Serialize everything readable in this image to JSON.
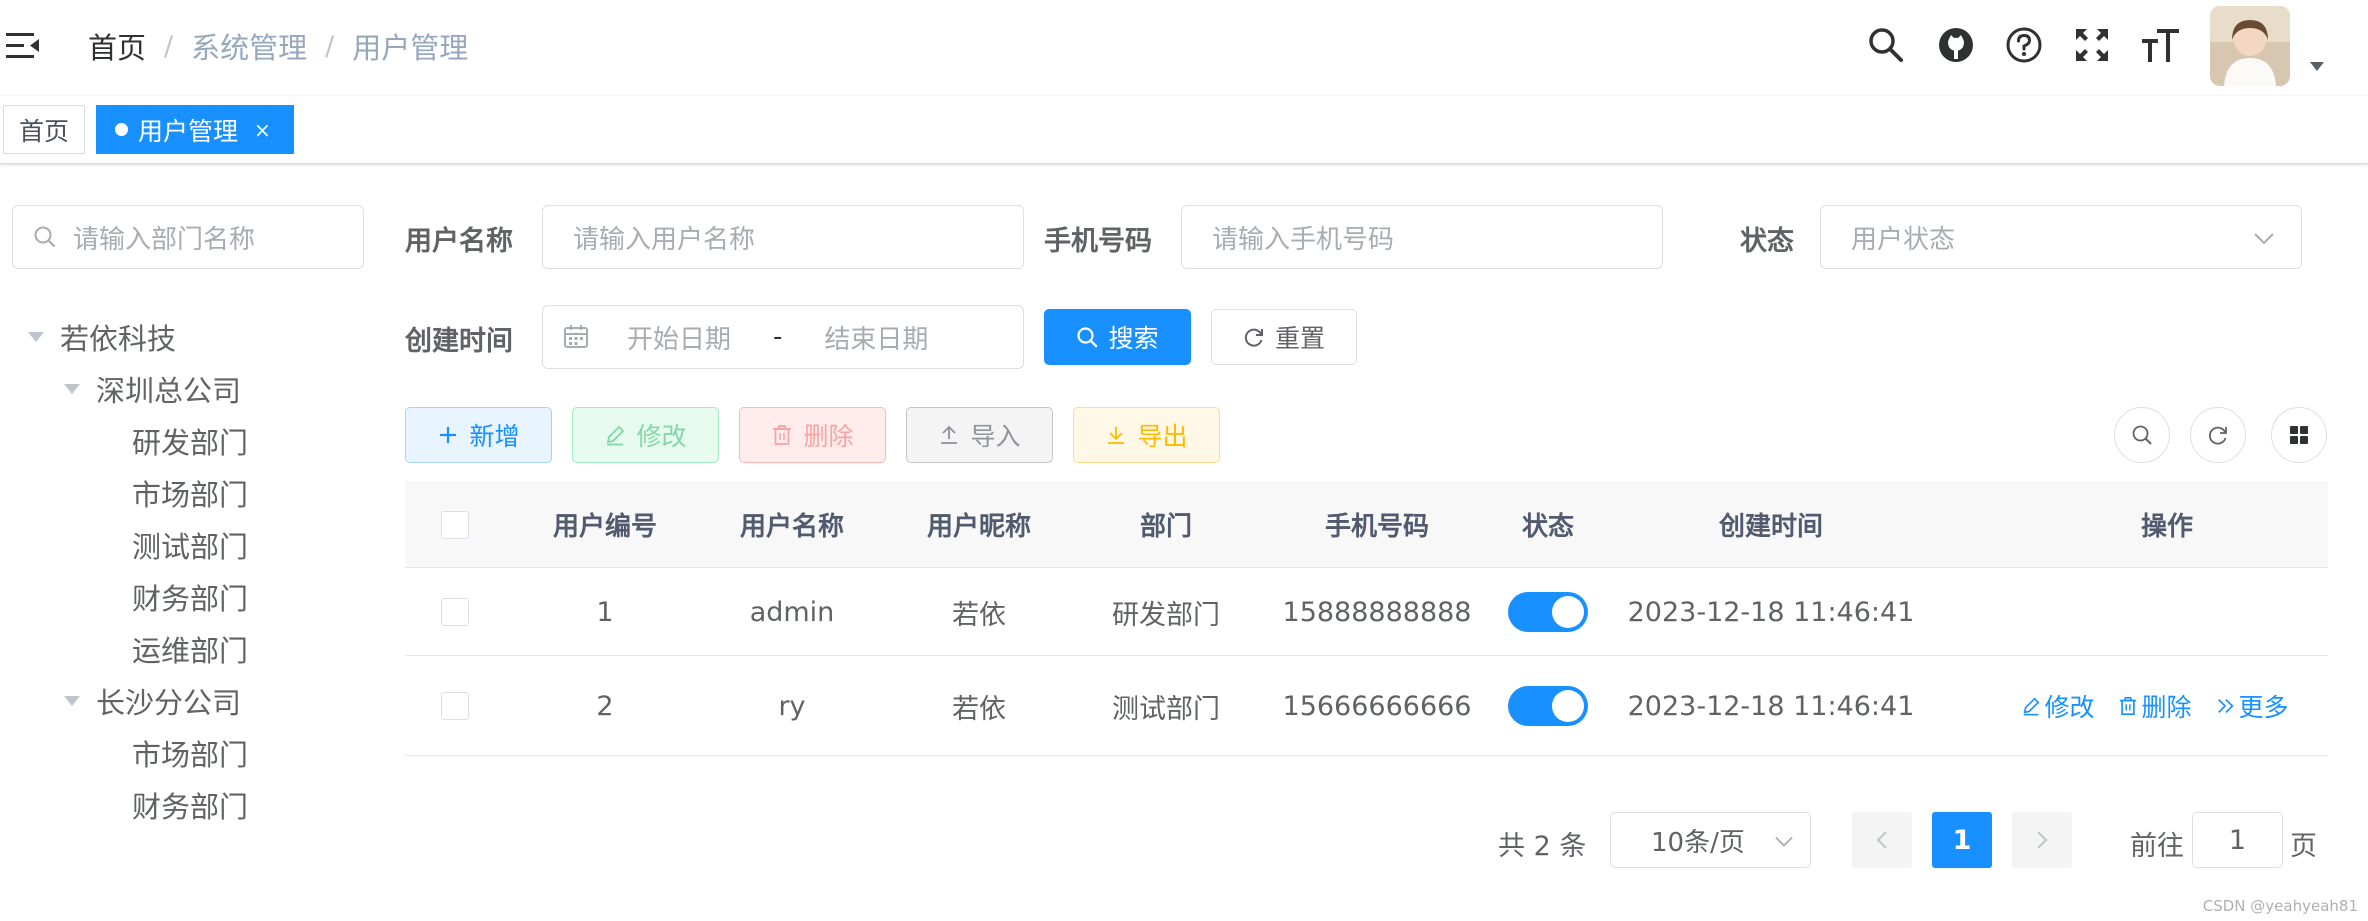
{
  "navbar": {
    "breadcrumb": [
      "首页",
      "系统管理",
      "用户管理"
    ],
    "icons": [
      "search-icon",
      "github-icon",
      "question-icon",
      "fullscreen-icon",
      "font-size-icon"
    ]
  },
  "tags": {
    "home": "首页",
    "active": "用户管理",
    "close": "×"
  },
  "dept_tree": {
    "search_placeholder": "请输入部门名称",
    "root": "若依科技",
    "branches": [
      {
        "label": "深圳总公司",
        "children": [
          "研发部门",
          "市场部门",
          "测试部门",
          "财务部门",
          "运维部门"
        ]
      },
      {
        "label": "长沙分公司",
        "children": [
          "市场部门",
          "财务部门"
        ]
      }
    ]
  },
  "query_form": {
    "username_label": "用户名称",
    "username_placeholder": "请输入用户名称",
    "phone_label": "手机号码",
    "phone_placeholder": "请输入手机号码",
    "status_label": "状态",
    "status_placeholder": "用户状态",
    "created_label": "创建时间",
    "start_placeholder": "开始日期",
    "range_separator": "-",
    "end_placeholder": "结束日期",
    "search_button": "搜索",
    "reset_button": "重置"
  },
  "toolbar": {
    "add": "新增",
    "edit": "修改",
    "delete": "删除",
    "import": "导入",
    "export": "导出"
  },
  "table": {
    "columns": [
      "用户编号",
      "用户名称",
      "用户昵称",
      "部门",
      "手机号码",
      "状态",
      "创建时间",
      "操作"
    ],
    "rows": [
      {
        "id": "1",
        "username": "admin",
        "nickname": "若依",
        "dept": "研发部门",
        "phone": "15888888888",
        "status": true,
        "created": "2023-12-18 11:46:41",
        "actions": []
      },
      {
        "id": "2",
        "username": "ry",
        "nickname": "若依",
        "dept": "测试部门",
        "phone": "15666666666",
        "status": true,
        "created": "2023-12-18 11:46:41",
        "actions": [
          "修改",
          "删除",
          "更多"
        ]
      }
    ]
  },
  "pagination": {
    "total_text": "共 2 条",
    "page_size": "10条/页",
    "current_page": "1",
    "goto_label": "前往",
    "goto_value": "1",
    "page_suffix": "页"
  },
  "watermark": "CSDN @yeahyeah81",
  "colors": {
    "primary": "#1890ff",
    "tag_border": "#d8dce5"
  }
}
